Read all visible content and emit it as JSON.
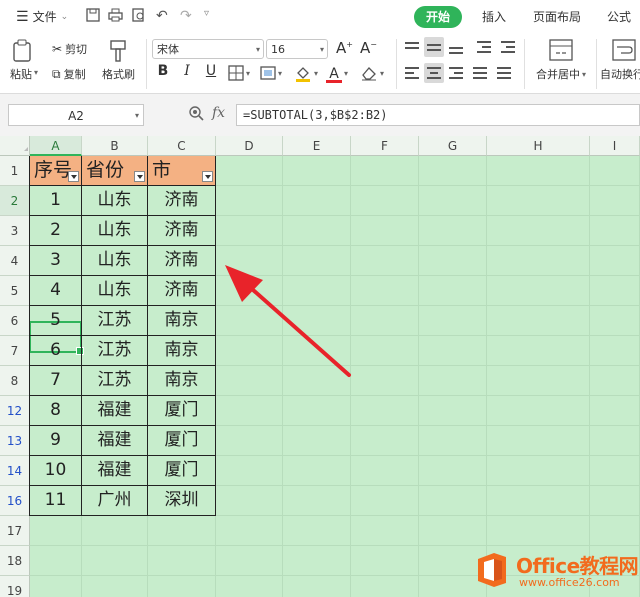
{
  "menubar": {
    "file_label": "文件",
    "tabs": [
      {
        "label": "开始",
        "active": true
      },
      {
        "label": "插入"
      },
      {
        "label": "页面布局"
      },
      {
        "label": "公式"
      }
    ]
  },
  "ribbon": {
    "paste_label": "粘贴",
    "cut_label": "剪切",
    "copy_label": "复制",
    "format_painter_label": "格式刷",
    "font_name": "宋体",
    "font_size": "16",
    "merge_label": "合并居中",
    "autowrap_label": "自动换行"
  },
  "formula_bar": {
    "cell_ref": "A2",
    "fx_label": "fx",
    "formula": "=SUBTOTAL(3,$B$2:B2)"
  },
  "sheet": {
    "columns": [
      "A",
      "B",
      "C",
      "D",
      "E",
      "F",
      "G",
      "H",
      "I"
    ],
    "row_numbers": [
      "1",
      "2",
      "3",
      "4",
      "5",
      "6",
      "7",
      "8",
      "12",
      "13",
      "14",
      "16",
      "17",
      "18",
      "19"
    ],
    "header_row": [
      "序号",
      "省份",
      "市"
    ],
    "rows": [
      [
        "1",
        "山东",
        "济南"
      ],
      [
        "2",
        "山东",
        "济南"
      ],
      [
        "3",
        "山东",
        "济南"
      ],
      [
        "4",
        "山东",
        "济南"
      ],
      [
        "5",
        "江苏",
        "南京"
      ],
      [
        "6",
        "江苏",
        "南京"
      ],
      [
        "7",
        "江苏",
        "南京"
      ],
      [
        "8",
        "福建",
        "厦门"
      ],
      [
        "9",
        "福建",
        "厦门"
      ],
      [
        "10",
        "福建",
        "厦门"
      ],
      [
        "11",
        "广州",
        "深圳"
      ]
    ]
  },
  "watermark": {
    "brand": "Office教程网",
    "url": "www.office26.com"
  },
  "colors": {
    "accent": "#2fb45a",
    "header_fill": "#f4b183",
    "grid_bg": "#c7edcc",
    "arrow": "#e8232a",
    "watermark_orange": "#f26b1d"
  }
}
